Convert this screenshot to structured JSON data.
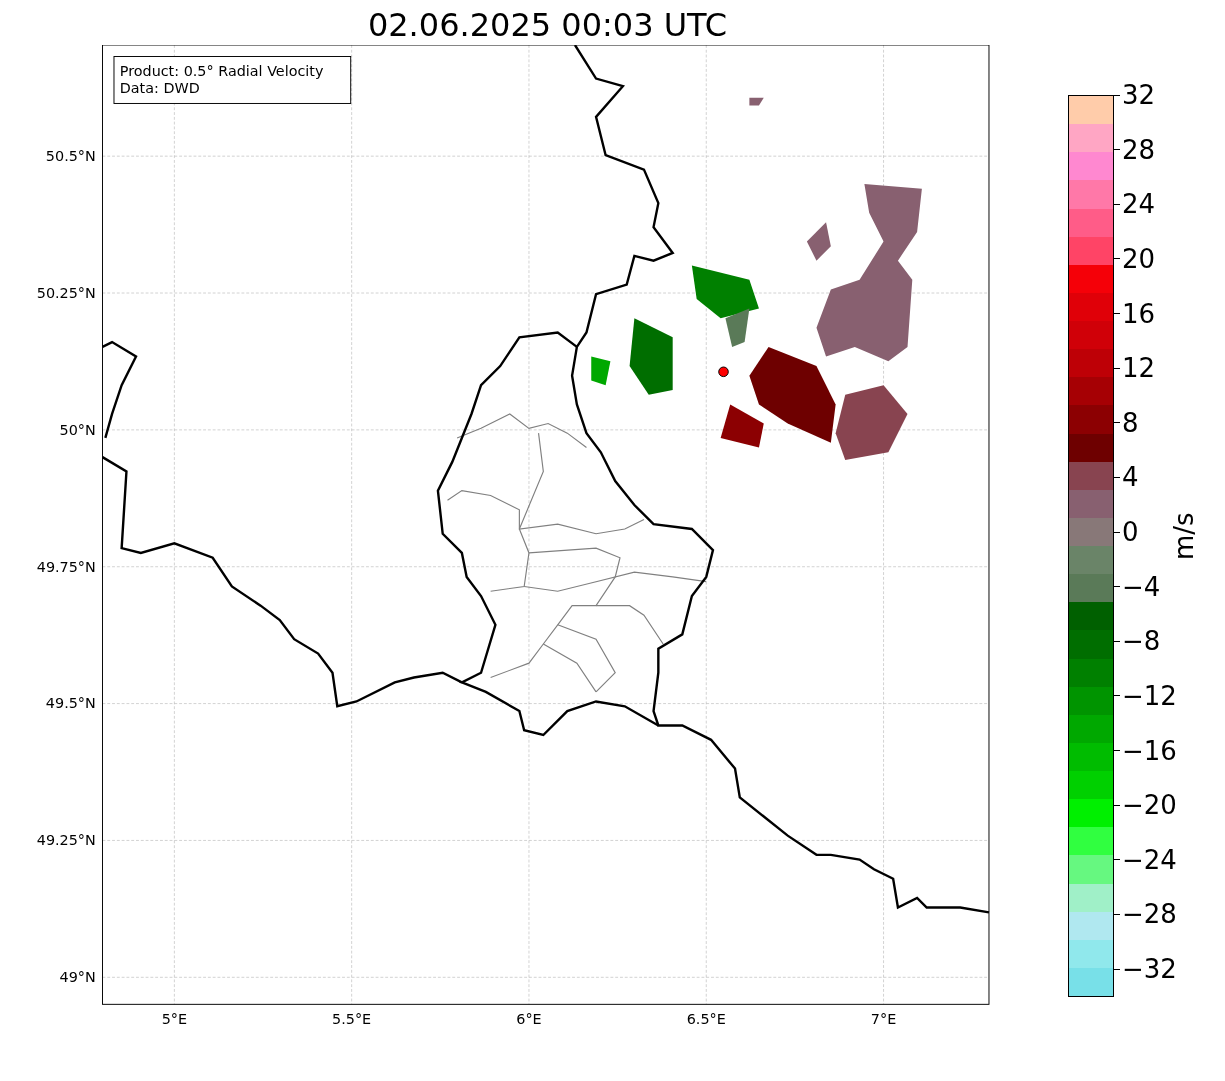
{
  "title": "02.06.2025 00:03 UTC",
  "info_box": {
    "lines": [
      "Product: 0.5° Radial Velocity",
      "Data: DWD"
    ]
  },
  "map": {
    "lat_ticks": [
      "50.5°N",
      "50.25°N",
      "50°N",
      "49.75°N",
      "49.5°N",
      "49.25°N",
      "49°N"
    ],
    "lon_ticks": [
      "5°E",
      "5.5°E",
      "6°E",
      "6.5°E",
      "7°E"
    ]
  },
  "colorbar": {
    "label": "m/s",
    "ticks": [
      "32",
      "28",
      "24",
      "20",
      "16",
      "12",
      "8",
      "4",
      "0",
      "−4",
      "−8",
      "−12",
      "−16",
      "−20",
      "−24",
      "−28",
      "−32"
    ],
    "bins": [
      {
        "color": "#ffccaa"
      },
      {
        "color": "#ffa6c4"
      },
      {
        "color": "#ff88d0"
      },
      {
        "color": "#ff78a8"
      },
      {
        "color": "#ff5c88"
      },
      {
        "color": "#ff4466"
      },
      {
        "color": "#f50008"
      },
      {
        "color": "#e00008"
      },
      {
        "color": "#d00008"
      },
      {
        "color": "#be0006"
      },
      {
        "color": "#a60004"
      },
      {
        "color": "#8c0002"
      },
      {
        "color": "#6e0000"
      },
      {
        "color": "#884450"
      },
      {
        "color": "#886070"
      },
      {
        "color": "#887878"
      },
      {
        "color": "#6a8468"
      },
      {
        "color": "#5a7a58"
      },
      {
        "color": "#006000"
      },
      {
        "color": "#006e00"
      },
      {
        "color": "#008000"
      },
      {
        "color": "#009400"
      },
      {
        "color": "#00a800"
      },
      {
        "color": "#00bc00"
      },
      {
        "color": "#00d000"
      },
      {
        "color": "#00f000"
      },
      {
        "color": "#30ff40"
      },
      {
        "color": "#66f880"
      },
      {
        "color": "#a0f0c8"
      },
      {
        "color": "#b0e8f0"
      },
      {
        "color": "#90e8ec"
      },
      {
        "color": "#78e0e8"
      }
    ]
  }
}
